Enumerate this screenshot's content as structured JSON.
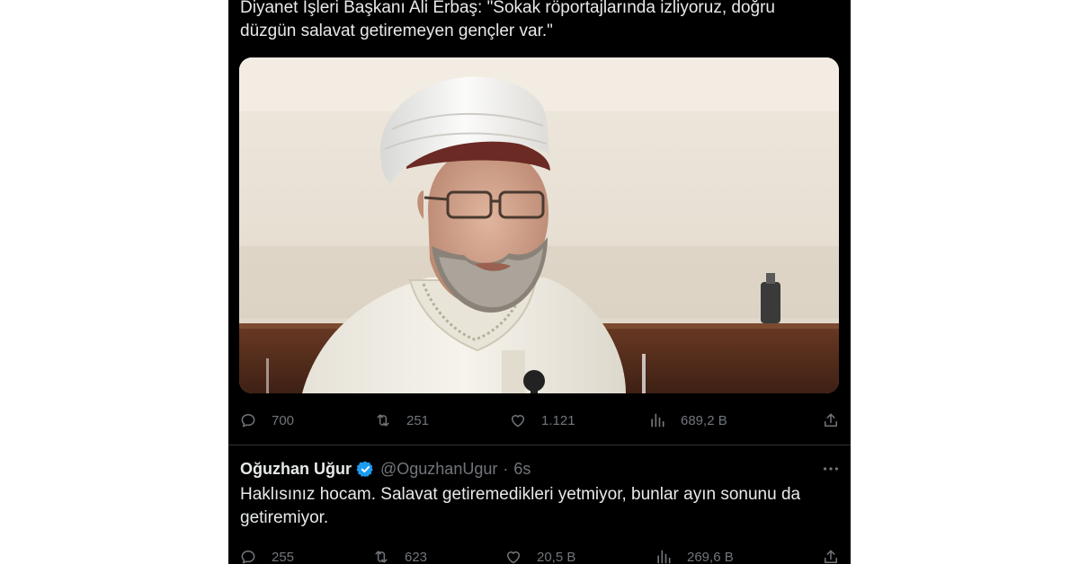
{
  "first_tweet": {
    "text": "Diyanet İşleri Başkanı Ali Erbaş: \"Sokak röportajlarında izliyoruz, doğru\ndüzgün salavat getiremeyen gençler var.\"",
    "actions": {
      "replies": "700",
      "retweets": "251",
      "likes": "1.121",
      "views": "689,2 B"
    }
  },
  "reply_tweet": {
    "author_name": "Oğuzhan Uğur",
    "handle": "@OguzhanUgur",
    "separator": "·",
    "time": "6s",
    "text": "Haklısınız hocam. Salavat getiremedikleri yetmiyor, bunlar ayın sonunu da\ngetiremiyor.",
    "actions": {
      "replies": "255",
      "retweets": "623",
      "likes": "20,5 B",
      "views": "269,6 B"
    }
  },
  "colors": {
    "background": "#000000",
    "text": "#e7e9ea",
    "muted": "#71767b",
    "verified": "#1d9bf0"
  },
  "icons": [
    "reply-icon",
    "retweet-icon",
    "like-icon",
    "views-icon",
    "share-icon",
    "verified-badge-icon",
    "more-icon"
  ]
}
